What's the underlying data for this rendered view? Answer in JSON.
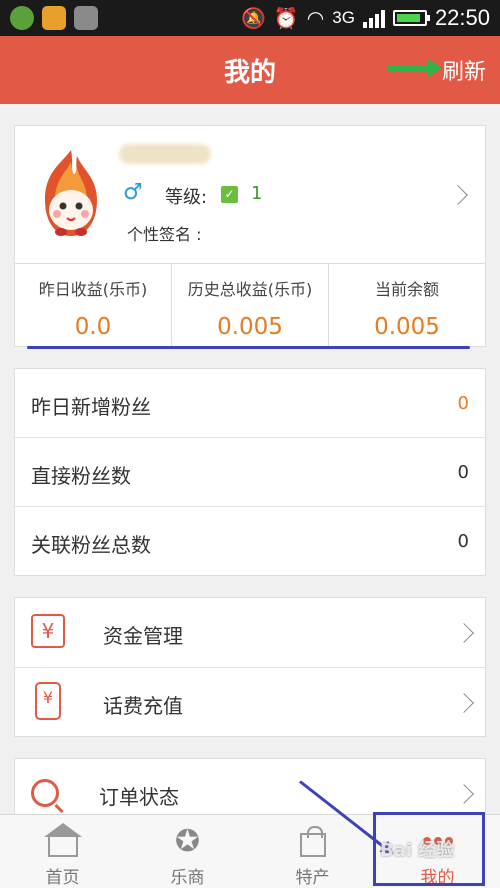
{
  "statusbar": {
    "network": "3G",
    "time": "22:50",
    "battery_level": 0.9
  },
  "header": {
    "title": "我的",
    "refresh_label": "刷新"
  },
  "profile": {
    "gender_symbol": "♂",
    "level_label": "等级:",
    "level_badge": "✓",
    "level_value": "1",
    "signature_label": "个性签名 :"
  },
  "stats": [
    {
      "label": "昨日收益(乐币)",
      "value": "0.0"
    },
    {
      "label": "历史总收益(乐币)",
      "value": "0.005"
    },
    {
      "label": "当前余额",
      "value": "0.005"
    }
  ],
  "fans": [
    {
      "label": "昨日新增粉丝",
      "value": "0"
    },
    {
      "label": "直接粉丝数",
      "value": "0"
    },
    {
      "label": "关联粉丝总数",
      "value": "0"
    }
  ],
  "finance": [
    {
      "label": "资金管理",
      "icon": "yuan-icon",
      "glyph": "¥"
    },
    {
      "label": "话费充值",
      "icon": "phone-icon",
      "glyph": "¥"
    }
  ],
  "orders": {
    "label": "订单状态"
  },
  "tabs": [
    {
      "label": "首页",
      "icon": "home-icon"
    },
    {
      "label": "乐商",
      "icon": "star-icon"
    },
    {
      "label": "特产",
      "icon": "bag-icon"
    },
    {
      "label": "我的",
      "icon": "profile-dots-icon"
    }
  ],
  "watermark": "Bai 经验",
  "colors": {
    "accent": "#e25a46",
    "value_orange": "#e57b23",
    "annotation_blue": "#3d43b6",
    "annotation_green": "#2fb44b"
  }
}
